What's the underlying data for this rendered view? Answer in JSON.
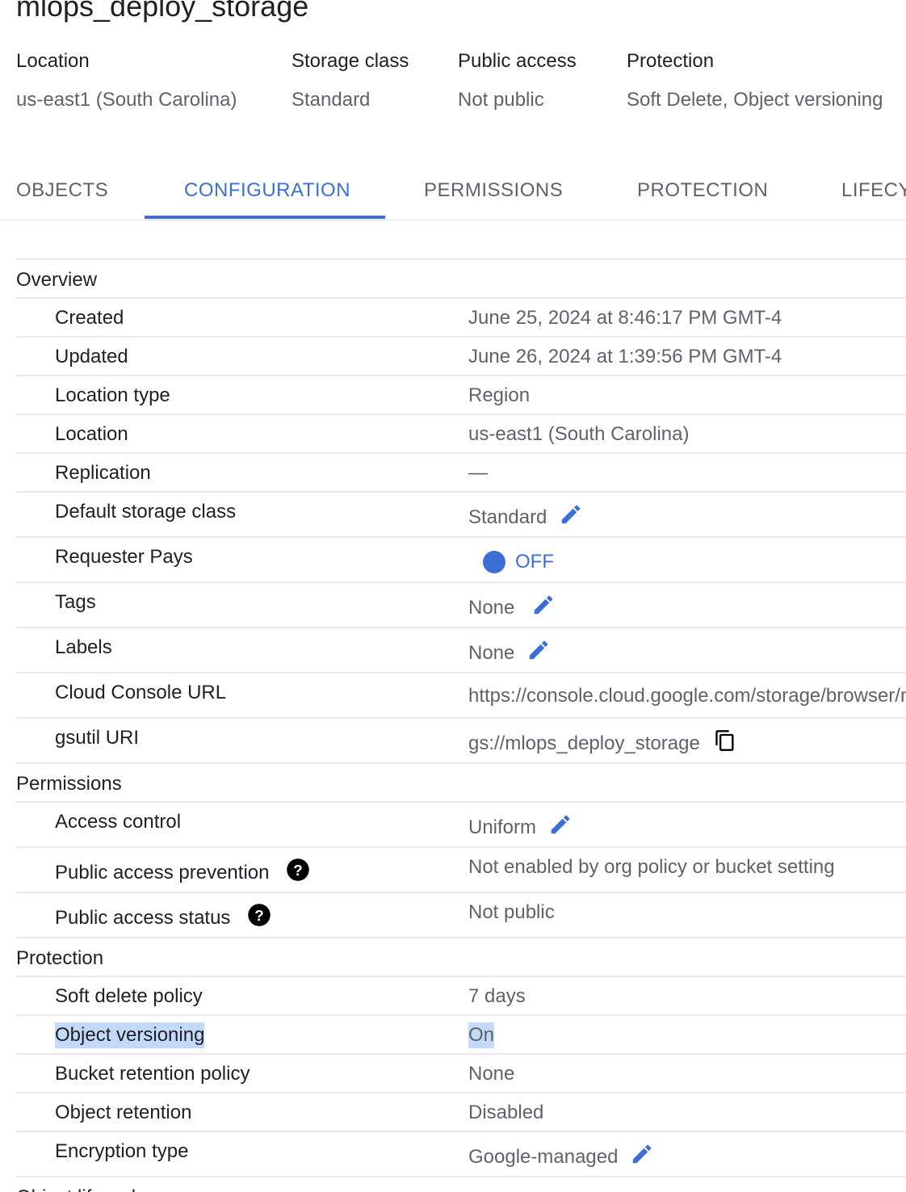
{
  "bucket": {
    "name": "mlops_deploy_storage"
  },
  "summary": {
    "location_label": "Location",
    "location_value": "us-east1 (South Carolina)",
    "storage_class_label": "Storage class",
    "storage_class_value": "Standard",
    "public_access_label": "Public access",
    "public_access_value": "Not public",
    "protection_label": "Protection",
    "protection_value": "Soft Delete, Object versioning"
  },
  "tabs": [
    {
      "label": "OBJECTS"
    },
    {
      "label": "CONFIGURATION"
    },
    {
      "label": "PERMISSIONS"
    },
    {
      "label": "PROTECTION"
    },
    {
      "label": "LIFECYCLE"
    }
  ],
  "active_tab": "CONFIGURATION",
  "overview": {
    "title": "Overview",
    "created": {
      "label": "Created",
      "value": "June 25, 2024 at 8:46:17 PM GMT-4"
    },
    "updated": {
      "label": "Updated",
      "value": "June 26, 2024 at 1:39:56 PM GMT-4"
    },
    "location_type": {
      "label": "Location type",
      "value": "Region"
    },
    "location": {
      "label": "Location",
      "value": "us-east1 (South Carolina)"
    },
    "replication": {
      "label": "Replication",
      "value": "—"
    },
    "default_storage_class": {
      "label": "Default storage class",
      "value": "Standard"
    },
    "requester_pays": {
      "label": "Requester Pays",
      "value": "OFF"
    },
    "tags": {
      "label": "Tags",
      "value": "None"
    },
    "labels": {
      "label": "Labels",
      "value": "None"
    },
    "console_url": {
      "label": "Cloud Console URL",
      "value": "https://console.cloud.google.com/storage/browser/mlops_deploy_storage"
    },
    "gsutil_uri": {
      "label": "gsutil URI",
      "value": "gs://mlops_deploy_storage"
    }
  },
  "permissions": {
    "title": "Permissions",
    "access_control": {
      "label": "Access control",
      "value": "Uniform"
    },
    "public_access_prevention": {
      "label": "Public access prevention",
      "value": "Not enabled by org policy or bucket setting"
    },
    "public_access_status": {
      "label": "Public access status",
      "value": "Not public"
    }
  },
  "protection": {
    "title": "Protection",
    "soft_delete_policy": {
      "label": "Soft delete policy",
      "value": "7 days"
    },
    "object_versioning": {
      "label": "Object versioning",
      "value": "On"
    },
    "bucket_retention_policy": {
      "label": "Bucket retention policy",
      "value": "None"
    },
    "object_retention": {
      "label": "Object retention",
      "value": "Disabled"
    },
    "encryption_type": {
      "label": "Encryption type",
      "value": "Google-managed"
    }
  },
  "next_section": {
    "title": "Object lifecycle"
  },
  "icons": {
    "edit": "pencil-icon",
    "copy": "copy-icon",
    "help": "help-circle-icon",
    "toggle": "toggle-off"
  },
  "colors": {
    "accent": "#3c6fd6",
    "text_primary": "#202124",
    "text_secondary": "#5f6368",
    "divider": "#e8eaed",
    "selection": "#c4dafa"
  }
}
